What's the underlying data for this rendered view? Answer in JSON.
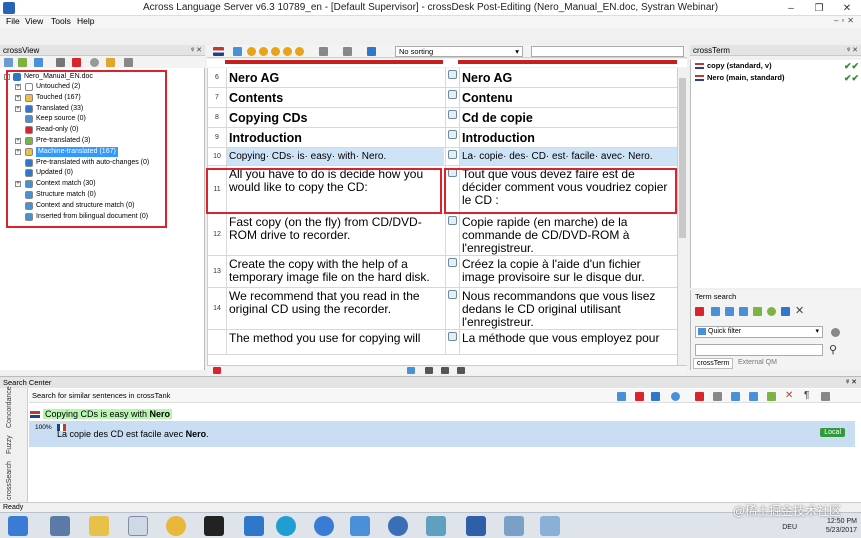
{
  "window": {
    "title": "Across Language Server v6.3 10789_en - [Default Supervisor] - crossDesk Post-Editing (Nero_Manual_EN.doc, Systran Webinar)",
    "controls": [
      "–",
      "❐",
      "✕"
    ]
  },
  "menu": [
    "File",
    "View",
    "Tools",
    "Help"
  ],
  "crossview": {
    "title": "crossView",
    "root": "Nero_Manual_EN.doc",
    "items": [
      {
        "label": "Untouched (2)",
        "color": "#ffffff",
        "expand": true
      },
      {
        "label": "Touched (167)",
        "color": "#e8c14b",
        "expand": true
      },
      {
        "label": "Translated (33)",
        "color": "#2f77c8",
        "expand": true
      },
      {
        "label": "Keep source (0)",
        "color": "#4a90d9",
        "expand": false
      },
      {
        "label": "Read-only (0)",
        "color": "#d9232d",
        "expand": false
      },
      {
        "label": "Pre-translated (3)",
        "color": "#7cb342",
        "expand": true
      },
      {
        "label": "Machine-translated (167)",
        "color": "#e8c14b",
        "expand": true,
        "selected": true
      },
      {
        "label": "Pre-translated with auto-changes (0)",
        "color": "#2f77c8",
        "expand": false
      },
      {
        "label": "Updated (0)",
        "color": "#2f77c8",
        "expand": false
      },
      {
        "label": "Context match (30)",
        "color": "#4a90d9",
        "expand": true
      },
      {
        "label": "Structure match (0)",
        "color": "#4a90d9",
        "expand": false
      },
      {
        "label": "Context and structure match (0)",
        "color": "#4a90d9",
        "expand": false
      },
      {
        "label": "Inserted from bilingual document (0)",
        "color": "#4a90d9",
        "expand": false
      }
    ]
  },
  "toolbar": {
    "sort_label": "No sorting"
  },
  "segments": [
    {
      "num": "6",
      "src": "Nero AG",
      "tgt": "Nero AG",
      "type": "heading"
    },
    {
      "num": "7",
      "src": "Contents",
      "tgt": "Contenu",
      "type": "heading"
    },
    {
      "num": "8",
      "src": "Copying CDs",
      "tgt": "Cd de copie",
      "type": "heading"
    },
    {
      "num": "9",
      "src": "Introduction",
      "tgt": "Introduction",
      "type": "heading"
    },
    {
      "num": "10",
      "src": "Copying· CDs· is· easy· with· Nero.",
      "tgt": "La· copie· des· CD· est· facile· avec· Nero.",
      "type": "active"
    },
    {
      "num": "11",
      "src": "All you have to do is decide how you would like to copy the CD:",
      "tgt": "Tout que vous devez faire est de décider comment vous voudriez copier le CD :",
      "type": "normal"
    },
    {
      "num": "12",
      "src": "Fast copy (on the fly) from CD/DVD-ROM drive to recorder.",
      "tgt": "Copie rapide (en marche) de la commande de CD/DVD-ROM à l'enregistreur.",
      "type": "normal"
    },
    {
      "num": "13",
      "src": "Create the copy with the help of a temporary image file on the hard disk.",
      "tgt": "Créez la copie à l'aide d'un fichier image provisoire sur le disque dur.",
      "type": "normal"
    },
    {
      "num": "14",
      "src": "We recommend that you read in the original CD using the recorder.",
      "tgt": "Nous recommandons que vous lisez dedans le CD original utilisant l'enregistreur.",
      "type": "normal"
    },
    {
      "num": "",
      "src": "The method you use for copying will",
      "tgt": "La méthode que vous employez pour",
      "type": "normal"
    }
  ],
  "crossterm": {
    "title": "crossTerm",
    "entries": [
      "copy (standard, v)",
      "Nero (main, standard)"
    ],
    "search_label": "Term search",
    "filter_label": "Quick filter",
    "tabs": [
      "crossTerm",
      "External QM"
    ]
  },
  "search_center": {
    "title": "Search Center",
    "subtitle": "Search for similar sentences in crossTank",
    "side_tabs": [
      "Concordance",
      "Fuzzy",
      "crossSearch"
    ],
    "src_prefix": "Copying CDs is easy with ",
    "src_bold": "Nero",
    "percent": "100%",
    "tgt_prefix": "La copie des CD est facile avec ",
    "tgt_bold": "Nero",
    "tgt_suffix": ".",
    "badge": "Local"
  },
  "status": "Ready",
  "tray": {
    "lang": "DEU",
    "time": "12:50 PM",
    "date": "5/23/2017"
  },
  "watermark": "@稀土掘金技术社区",
  "colors": {
    "selection": "#3399ff",
    "active_row": "#cfe3f7",
    "red_box": "#d9232d",
    "match_highlight": "#b8f5b0"
  }
}
